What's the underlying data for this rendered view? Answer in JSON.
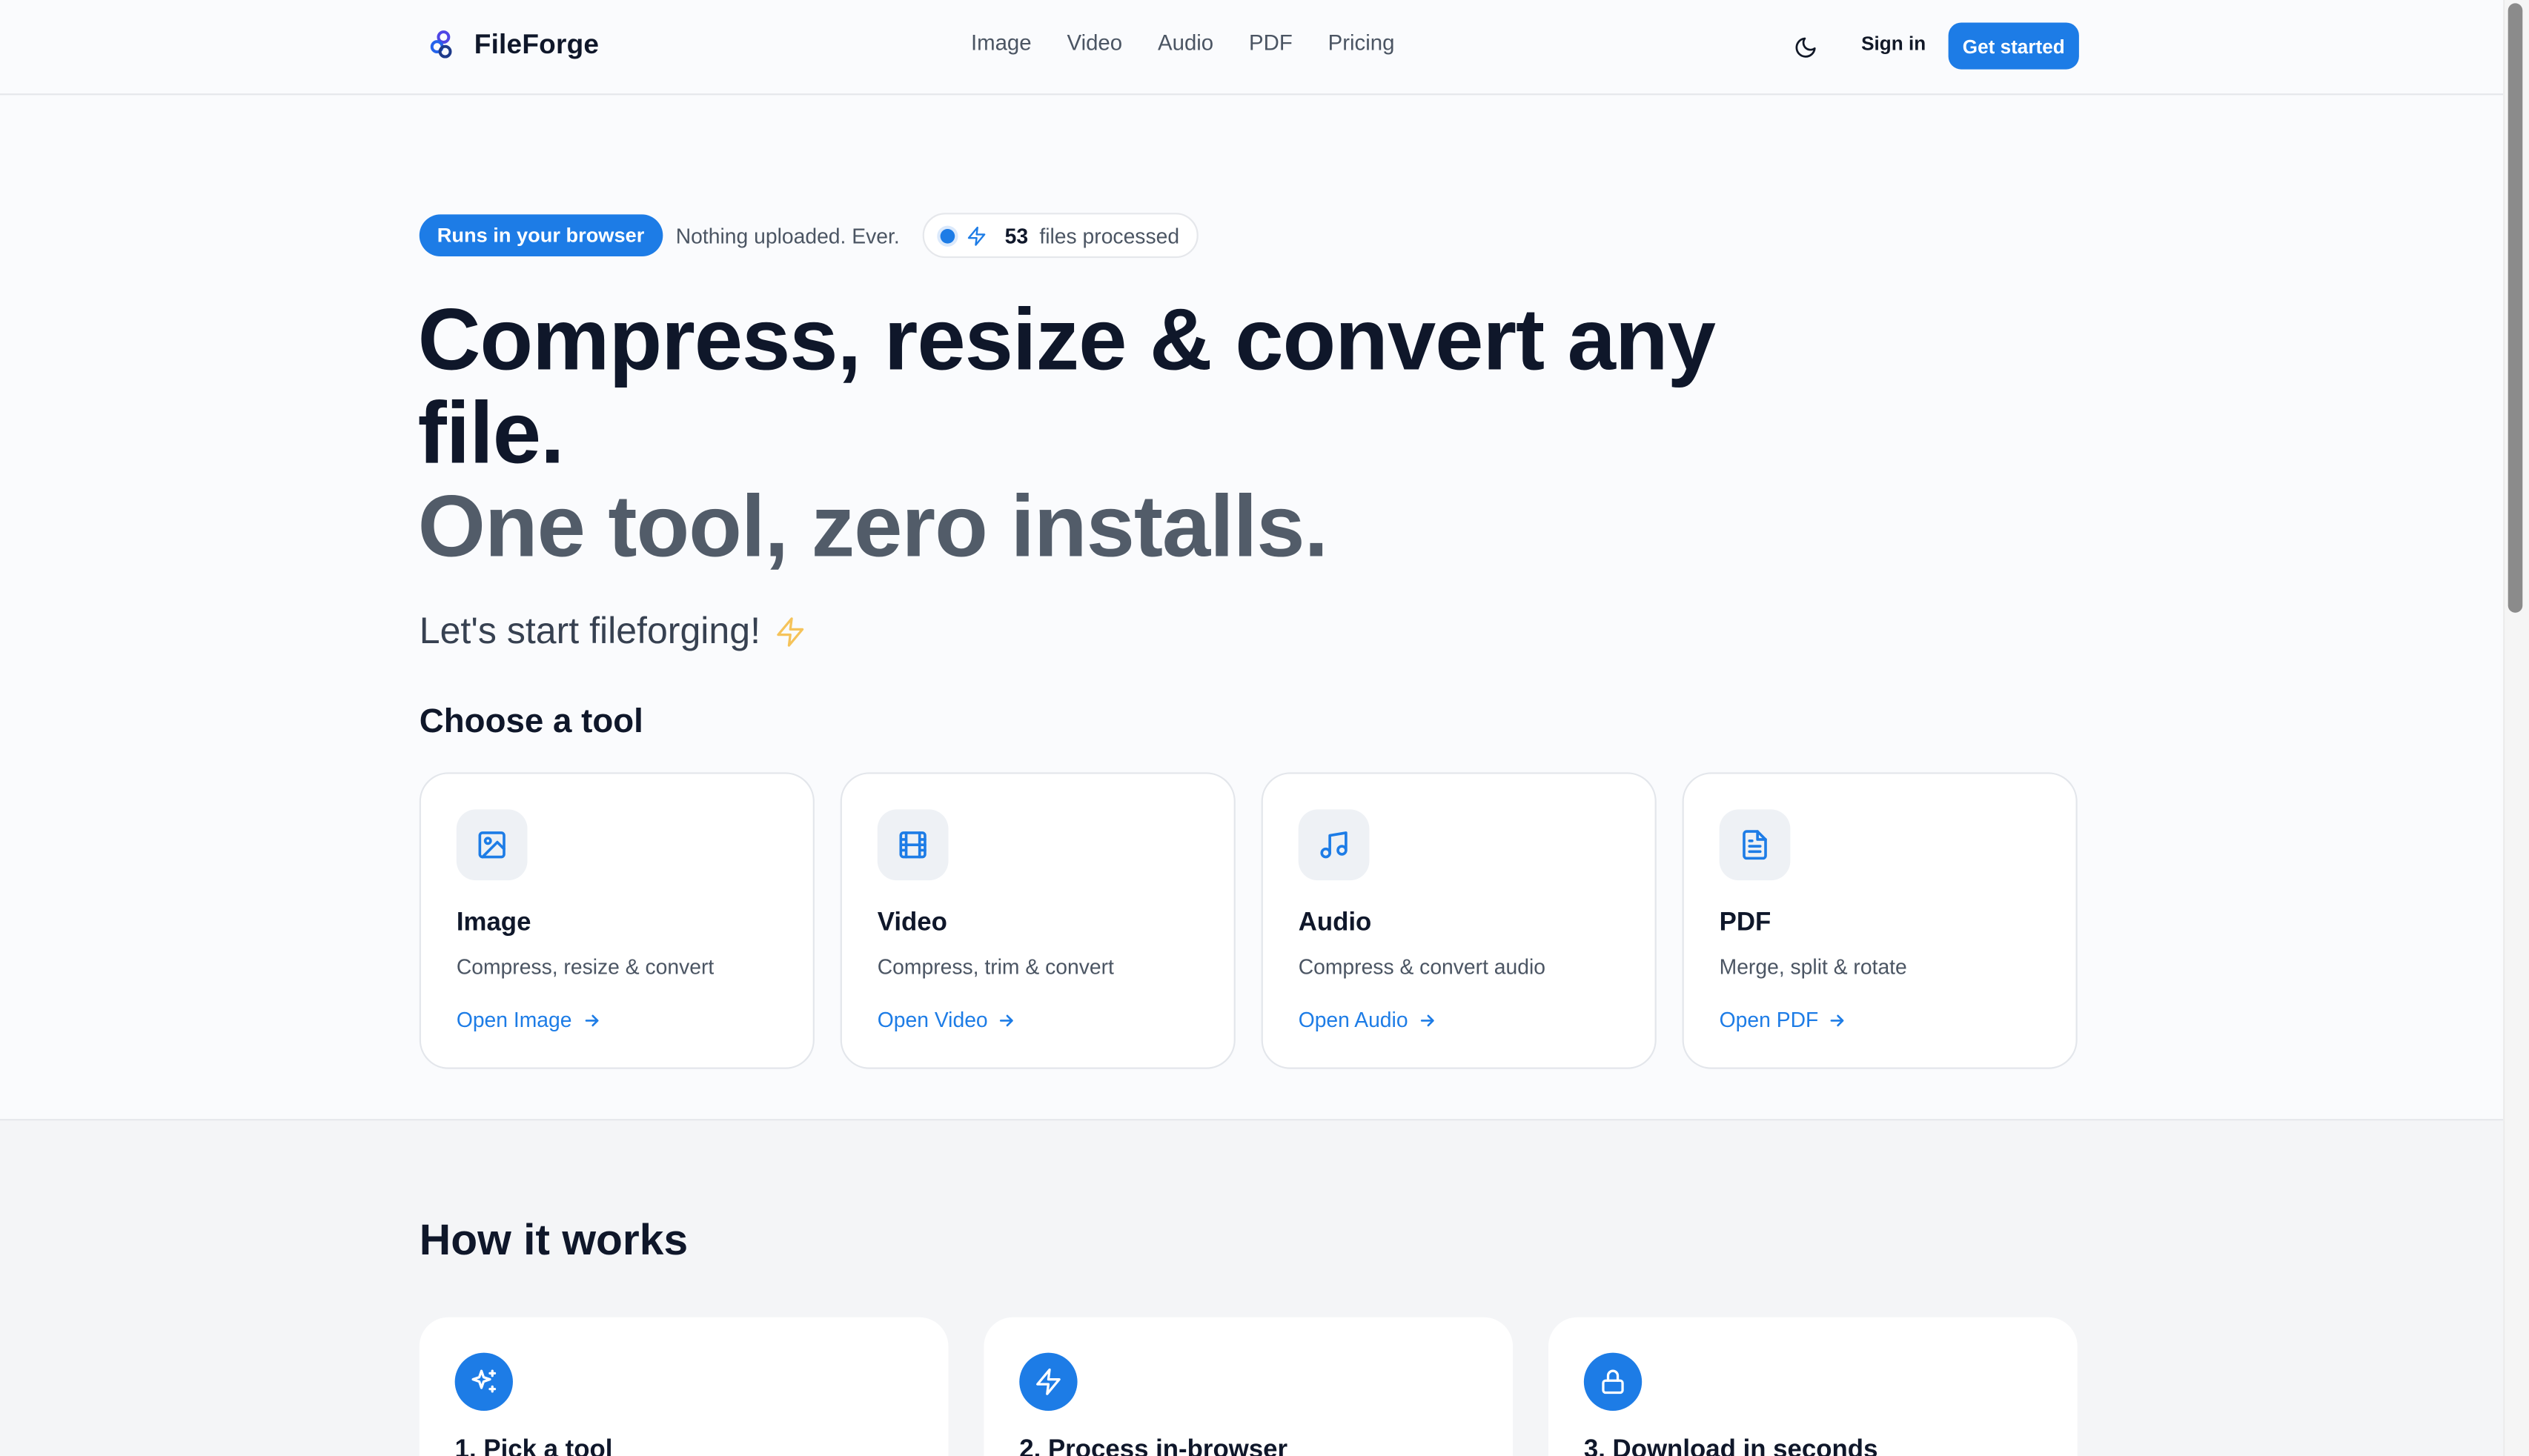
{
  "brand": {
    "name": "FileForge"
  },
  "nav": {
    "items": [
      "Image",
      "Video",
      "Audio",
      "PDF",
      "Pricing"
    ]
  },
  "header": {
    "signin": "Sign in",
    "cta": "Get started"
  },
  "hero": {
    "badge": "Runs in your browser",
    "privacy_note": "Nothing uploaded. Ever.",
    "files_count": "53",
    "files_label": "files processed",
    "title": "Compress, resize & convert any file.",
    "title_muted": "One tool, zero installs.",
    "tagline": "Let's start fileforging!"
  },
  "tools": {
    "heading": "Choose a tool",
    "items": [
      {
        "title": "Image",
        "desc": "Compress, resize & convert",
        "link": "Open Image",
        "icon": "image-icon"
      },
      {
        "title": "Video",
        "desc": "Compress, trim & convert",
        "link": "Open Video",
        "icon": "film-icon"
      },
      {
        "title": "Audio",
        "desc": "Compress & convert audio",
        "link": "Open Audio",
        "icon": "music-icon"
      },
      {
        "title": "PDF",
        "desc": "Merge, split & rotate",
        "link": "Open PDF",
        "icon": "file-text-icon"
      }
    ]
  },
  "how": {
    "heading": "How it works",
    "steps": [
      {
        "title": "1. Pick a tool",
        "icon": "sparkles-icon"
      },
      {
        "title": "2. Process in-browser",
        "icon": "zap-icon"
      },
      {
        "title": "3. Download in seconds",
        "icon": "lock-icon"
      }
    ]
  },
  "colors": {
    "accent": "#1d7ce6",
    "text": "#0f172a",
    "muted": "#525c69"
  }
}
